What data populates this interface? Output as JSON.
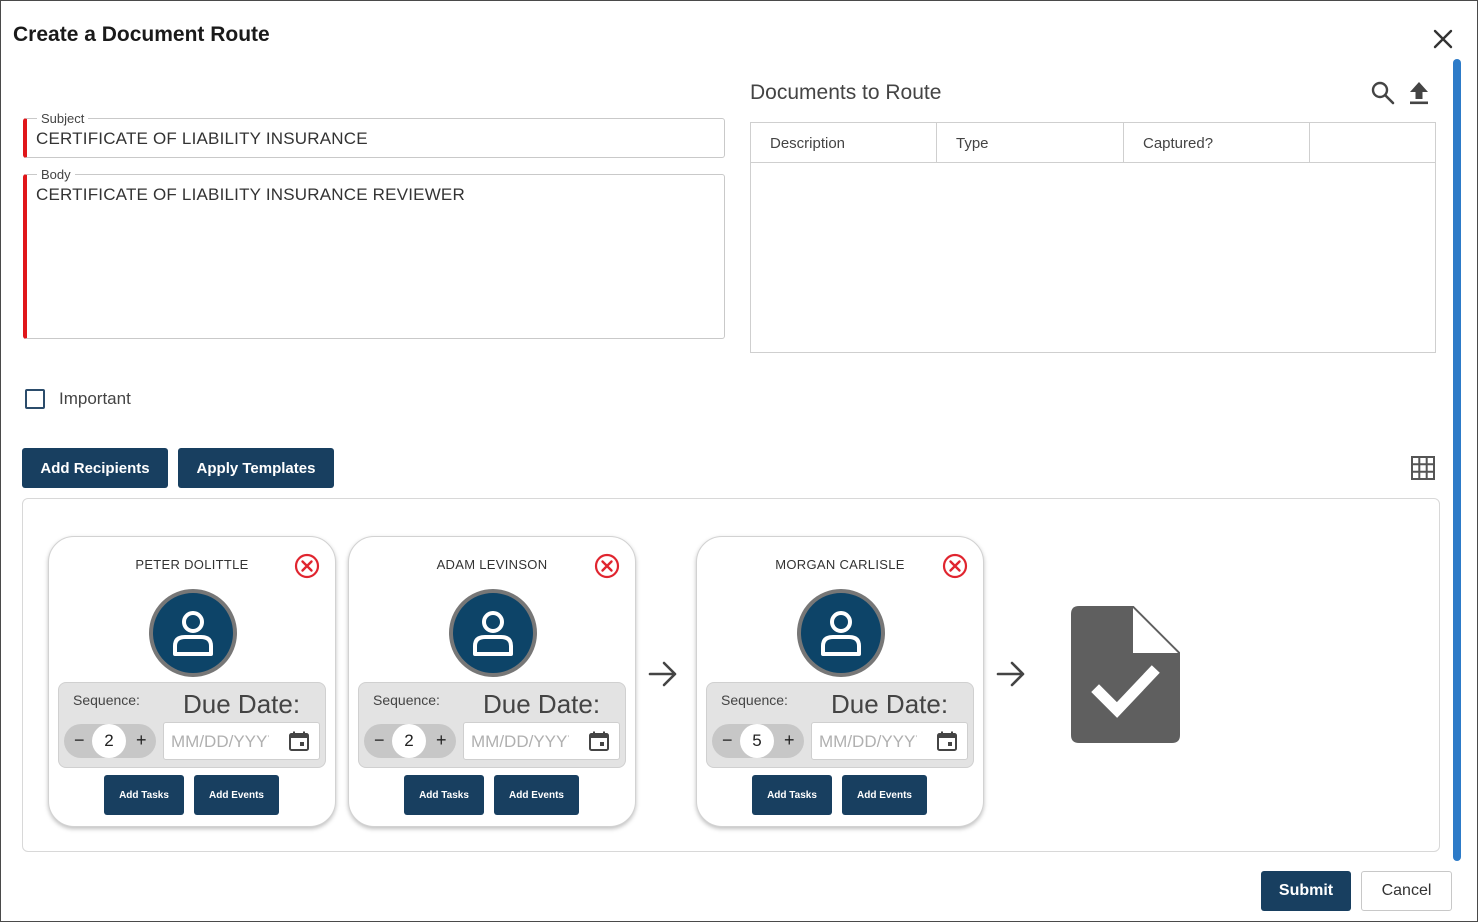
{
  "dialog": {
    "title": "Create a Document Route"
  },
  "form": {
    "subject": {
      "label": "Subject",
      "value": "CERTIFICATE OF LIABILITY INSURANCE"
    },
    "body": {
      "label": "Body",
      "value": "CERTIFICATE OF LIABILITY INSURANCE REVIEWER"
    },
    "important": {
      "label": "Important",
      "checked": false
    }
  },
  "actions": {
    "add_recipients": "Add Recipients",
    "apply_templates": "Apply Templates"
  },
  "documents": {
    "title": "Documents to Route",
    "columns": [
      "Description",
      "Type",
      "Captured?",
      ""
    ],
    "rows": []
  },
  "recipients": [
    {
      "name": "PETER DOLITTLE",
      "sequence_label": "Sequence:",
      "due_label": "Due Date:",
      "sequence": "2",
      "minus": "−",
      "plus": "+",
      "date_placeholder": "MM/DD/YYYY",
      "add_tasks": "Add Tasks",
      "add_events": "Add Events"
    },
    {
      "name": "ADAM LEVINSON",
      "sequence_label": "Sequence:",
      "due_label": "Due Date:",
      "sequence": "2",
      "minus": "−",
      "plus": "+",
      "date_placeholder": "MM/DD/YYYY",
      "add_tasks": "Add Tasks",
      "add_events": "Add Events"
    },
    {
      "name": "MORGAN CARLISLE",
      "sequence_label": "Sequence:",
      "due_label": "Due Date:",
      "sequence": "5",
      "minus": "−",
      "plus": "+",
      "date_placeholder": "MM/DD/YYYY",
      "add_tasks": "Add Tasks",
      "add_events": "Add Events"
    }
  ],
  "footer": {
    "submit": "Submit",
    "cancel": "Cancel"
  },
  "icons": {
    "close": "close-icon",
    "search": "search-icon",
    "upload": "upload-icon",
    "grid": "grid-icon",
    "remove": "remove-circle-icon",
    "avatar": "user-icon",
    "calendar": "calendar-icon",
    "arrow": "arrow-right-icon",
    "document_check": "document-check-icon"
  },
  "colors": {
    "primary": "#183f60",
    "required": "#e0161a",
    "remove": "#e0252f",
    "avatar_bg": "#0d4468",
    "scrollbar": "#2d7bc8"
  }
}
